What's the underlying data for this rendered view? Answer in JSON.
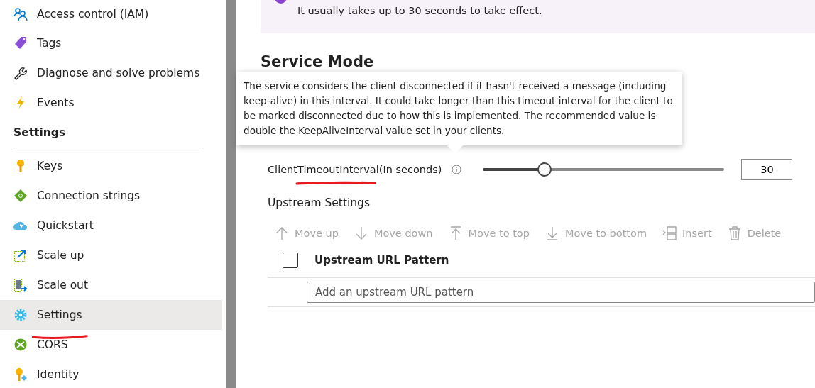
{
  "sidebar": {
    "items": [
      {
        "kind": "item",
        "label": "Access control (IAM)",
        "selected": false
      },
      {
        "kind": "item",
        "label": "Tags",
        "selected": false
      },
      {
        "kind": "item",
        "label": "Diagnose and solve problems",
        "selected": false
      },
      {
        "kind": "item",
        "label": "Events",
        "selected": false
      },
      {
        "kind": "header",
        "label": "Settings"
      },
      {
        "kind": "item",
        "label": "Keys",
        "selected": false
      },
      {
        "kind": "item",
        "label": "Connection strings",
        "selected": false
      },
      {
        "kind": "item",
        "label": "Quickstart",
        "selected": false
      },
      {
        "kind": "item",
        "label": "Scale up",
        "selected": false
      },
      {
        "kind": "item",
        "label": "Scale out",
        "selected": false
      },
      {
        "kind": "item",
        "label": "Settings",
        "selected": true
      },
      {
        "kind": "item",
        "label": "CORS",
        "selected": false
      },
      {
        "kind": "item",
        "label": "Identity",
        "selected": false
      }
    ]
  },
  "banner": {
    "text": "It usually takes up to 30 seconds to take effect."
  },
  "section_title": "Service Mode",
  "tooltip": "The service considers the client disconnected if it hasn't received a message (including keep-alive) in this interval. It could take longer than this timeout interval for the client to be marked disconnected due to how this is implemented. The recommended value is double the KeepAliveInterval value set in your clients.",
  "timeout": {
    "label": "ClientTimeoutInterval(In seconds)",
    "level": 0.24,
    "value": "30"
  },
  "upstream": {
    "title": "Upstream Settings",
    "toolbar": [
      {
        "label": "Move up",
        "disabled": true
      },
      {
        "label": "Move down",
        "disabled": true
      },
      {
        "label": "Move to top",
        "disabled": true
      },
      {
        "label": "Move to bottom",
        "disabled": true
      },
      {
        "label": "Insert",
        "disabled": true
      },
      {
        "label": "Delete",
        "disabled": true
      }
    ],
    "column": "Upstream URL Pattern",
    "select_all_checked": false,
    "placeholder": "Add an upstream URL pattern"
  }
}
